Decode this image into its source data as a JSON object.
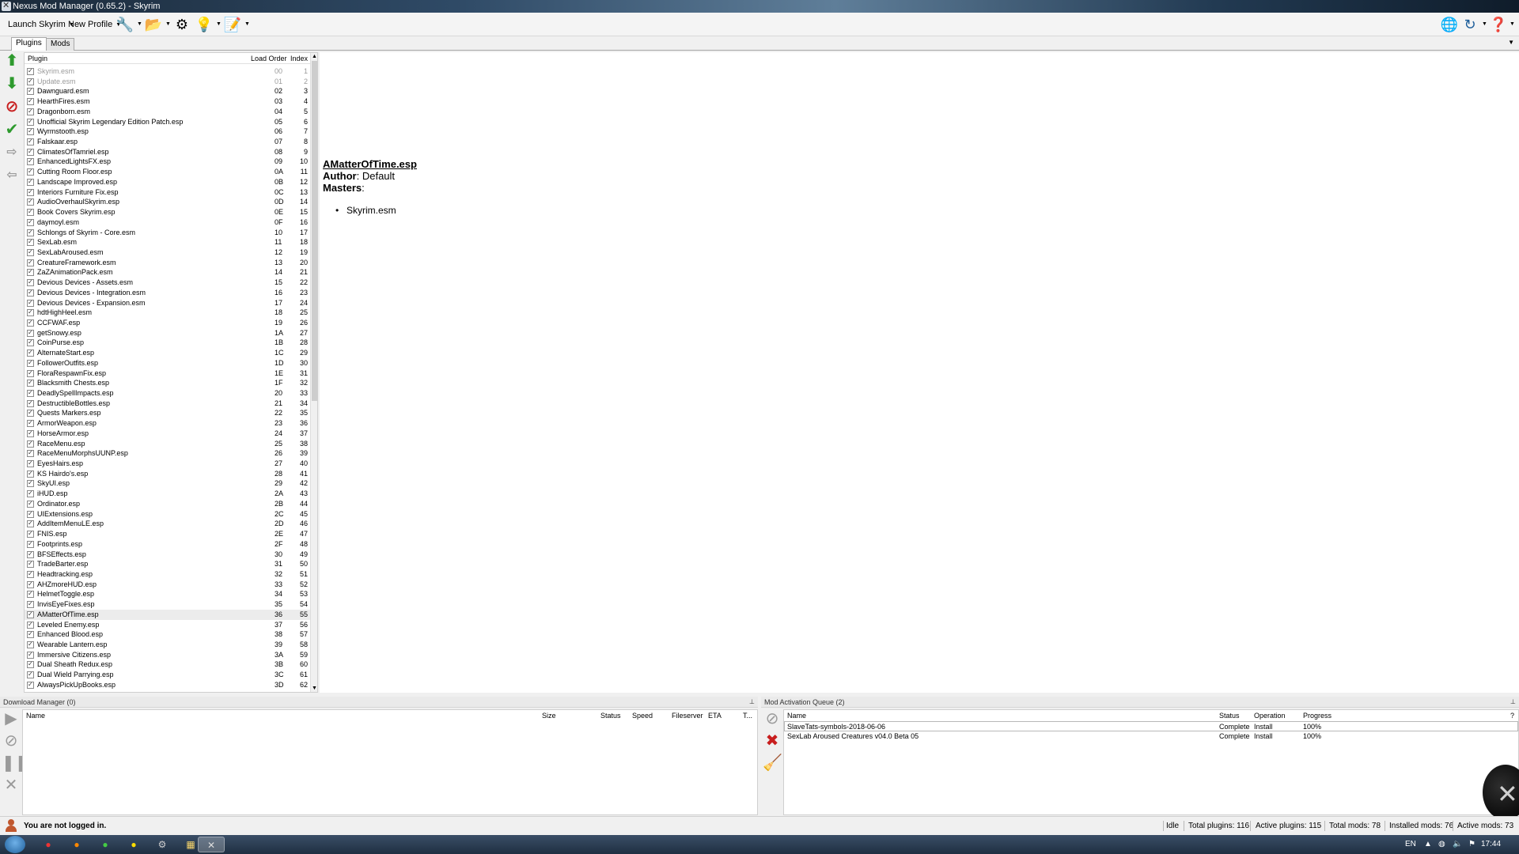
{
  "window": {
    "title": "Nexus Mod Manager (0.65.2) - Skyrim"
  },
  "toolbar": {
    "launch_label": "Launch Skyrim",
    "profile_label": "New Profile"
  },
  "tabs": [
    {
      "label": "Plugins"
    },
    {
      "label": "Mods"
    }
  ],
  "plugins": {
    "columns": {
      "plugin": "Plugin",
      "load_order": "Load Order",
      "index": "Index"
    },
    "selected_index": 55,
    "rows": [
      {
        "name": "Skyrim.esm",
        "load_order": "00",
        "index": "1",
        "dim": true
      },
      {
        "name": "Update.esm",
        "load_order": "01",
        "index": "2",
        "dim": true
      },
      {
        "name": "Dawnguard.esm",
        "load_order": "02",
        "index": "3"
      },
      {
        "name": "HearthFires.esm",
        "load_order": "03",
        "index": "4"
      },
      {
        "name": "Dragonborn.esm",
        "load_order": "04",
        "index": "5"
      },
      {
        "name": "Unofficial Skyrim Legendary Edition Patch.esp",
        "load_order": "05",
        "index": "6"
      },
      {
        "name": "Wyrmstooth.esp",
        "load_order": "06",
        "index": "7"
      },
      {
        "name": "Falskaar.esp",
        "load_order": "07",
        "index": "8"
      },
      {
        "name": "ClimatesOfTamriel.esp",
        "load_order": "08",
        "index": "9"
      },
      {
        "name": "EnhancedLightsFX.esp",
        "load_order": "09",
        "index": "10"
      },
      {
        "name": "Cutting Room Floor.esp",
        "load_order": "0A",
        "index": "11"
      },
      {
        "name": "Landscape Improved.esp",
        "load_order": "0B",
        "index": "12"
      },
      {
        "name": "Interiors Furniture Fix.esp",
        "load_order": "0C",
        "index": "13"
      },
      {
        "name": "AudioOverhaulSkyrim.esp",
        "load_order": "0D",
        "index": "14"
      },
      {
        "name": "Book Covers Skyrim.esp",
        "load_order": "0E",
        "index": "15"
      },
      {
        "name": "daymoyl.esm",
        "load_order": "0F",
        "index": "16"
      },
      {
        "name": "Schlongs of Skyrim - Core.esm",
        "load_order": "10",
        "index": "17"
      },
      {
        "name": "SexLab.esm",
        "load_order": "11",
        "index": "18"
      },
      {
        "name": "SexLabAroused.esm",
        "load_order": "12",
        "index": "19"
      },
      {
        "name": "CreatureFramework.esm",
        "load_order": "13",
        "index": "20"
      },
      {
        "name": "ZaZAnimationPack.esm",
        "load_order": "14",
        "index": "21"
      },
      {
        "name": "Devious Devices - Assets.esm",
        "load_order": "15",
        "index": "22"
      },
      {
        "name": "Devious Devices - Integration.esm",
        "load_order": "16",
        "index": "23"
      },
      {
        "name": "Devious Devices - Expansion.esm",
        "load_order": "17",
        "index": "24"
      },
      {
        "name": "hdtHighHeel.esm",
        "load_order": "18",
        "index": "25"
      },
      {
        "name": "CCFWAF.esp",
        "load_order": "19",
        "index": "26"
      },
      {
        "name": "getSnowy.esp",
        "load_order": "1A",
        "index": "27"
      },
      {
        "name": "CoinPurse.esp",
        "load_order": "1B",
        "index": "28"
      },
      {
        "name": "AlternateStart.esp",
        "load_order": "1C",
        "index": "29"
      },
      {
        "name": "FollowerOutfits.esp",
        "load_order": "1D",
        "index": "30"
      },
      {
        "name": "FloraRespawnFix.esp",
        "load_order": "1E",
        "index": "31"
      },
      {
        "name": "Blacksmith Chests.esp",
        "load_order": "1F",
        "index": "32"
      },
      {
        "name": "DeadlySpellImpacts.esp",
        "load_order": "20",
        "index": "33"
      },
      {
        "name": "DestructibleBottles.esp",
        "load_order": "21",
        "index": "34"
      },
      {
        "name": "Quests Markers.esp",
        "load_order": "22",
        "index": "35"
      },
      {
        "name": "ArmorWeapon.esp",
        "load_order": "23",
        "index": "36"
      },
      {
        "name": "HorseArmor.esp",
        "load_order": "24",
        "index": "37"
      },
      {
        "name": "RaceMenu.esp",
        "load_order": "25",
        "index": "38"
      },
      {
        "name": "RaceMenuMorphsUUNP.esp",
        "load_order": "26",
        "index": "39"
      },
      {
        "name": "EyesHairs.esp",
        "load_order": "27",
        "index": "40"
      },
      {
        "name": "KS Hairdo's.esp",
        "load_order": "28",
        "index": "41"
      },
      {
        "name": "SkyUI.esp",
        "load_order": "29",
        "index": "42"
      },
      {
        "name": "iHUD.esp",
        "load_order": "2A",
        "index": "43"
      },
      {
        "name": "Ordinator.esp",
        "load_order": "2B",
        "index": "44"
      },
      {
        "name": "UIExtensions.esp",
        "load_order": "2C",
        "index": "45"
      },
      {
        "name": "AddItemMenuLE.esp",
        "load_order": "2D",
        "index": "46"
      },
      {
        "name": "FNIS.esp",
        "load_order": "2E",
        "index": "47"
      },
      {
        "name": "Footprints.esp",
        "load_order": "2F",
        "index": "48"
      },
      {
        "name": "BFSEffects.esp",
        "load_order": "30",
        "index": "49"
      },
      {
        "name": "TradeBarter.esp",
        "load_order": "31",
        "index": "50"
      },
      {
        "name": "Headtracking.esp",
        "load_order": "32",
        "index": "51"
      },
      {
        "name": "AHZmoreHUD.esp",
        "load_order": "33",
        "index": "52"
      },
      {
        "name": "HelmetToggle.esp",
        "load_order": "34",
        "index": "53"
      },
      {
        "name": "InvisEyeFixes.esp",
        "load_order": "35",
        "index": "54"
      },
      {
        "name": "AMatterOfTime.esp",
        "load_order": "36",
        "index": "55"
      },
      {
        "name": "Leveled Enemy.esp",
        "load_order": "37",
        "index": "56"
      },
      {
        "name": "Enhanced Blood.esp",
        "load_order": "38",
        "index": "57"
      },
      {
        "name": "Wearable Lantern.esp",
        "load_order": "39",
        "index": "58"
      },
      {
        "name": "Immersive Citizens.esp",
        "load_order": "3A",
        "index": "59"
      },
      {
        "name": "Dual Sheath Redux.esp",
        "load_order": "3B",
        "index": "60"
      },
      {
        "name": "Dual Wield Parrying.esp",
        "load_order": "3C",
        "index": "61"
      },
      {
        "name": "AlwaysPickUpBooks.esp",
        "load_order": "3D",
        "index": "62"
      }
    ]
  },
  "plugin_info": {
    "title": "AMatterOfTime.esp",
    "author_label": "Author",
    "author_value": ": Default",
    "masters_label": "Masters",
    "masters_colon": ":",
    "masters": [
      "Skyrim.esm"
    ]
  },
  "download_manager": {
    "title": "Download Manager (0)",
    "columns": [
      "Name",
      "Size",
      "Status",
      "Speed",
      "Fileserver",
      "ETA",
      "T..."
    ]
  },
  "mod_queue": {
    "title": "Mod Activation Queue (2)",
    "columns": [
      "Name",
      "Status",
      "Operation",
      "Progress",
      "?"
    ],
    "rows": [
      {
        "name": "SlaveTats-symbols-2018-06-06",
        "status": "Complete",
        "operation": "Install",
        "progress": "100%"
      },
      {
        "name": "SexLab Aroused Creatures v04.0 Beta 05",
        "status": "Complete",
        "operation": "Install",
        "progress": "100%"
      }
    ]
  },
  "status": {
    "login": "You are not logged in.",
    "idle": "Idle",
    "total_plugins": "Total plugins: 116",
    "active_plugins": "Active plugins:  115",
    "total_mods": "Total mods: 78",
    "installed_mods": "Installed mods: 76",
    "active_mods": "Active mods: 73"
  },
  "taskbar": {
    "lang": "EN",
    "clock": "17:44"
  },
  "colors": {
    "accent_green": "#2e9a2e",
    "danger_red": "#c81e1e",
    "link_blue": "#1f5f9b"
  }
}
